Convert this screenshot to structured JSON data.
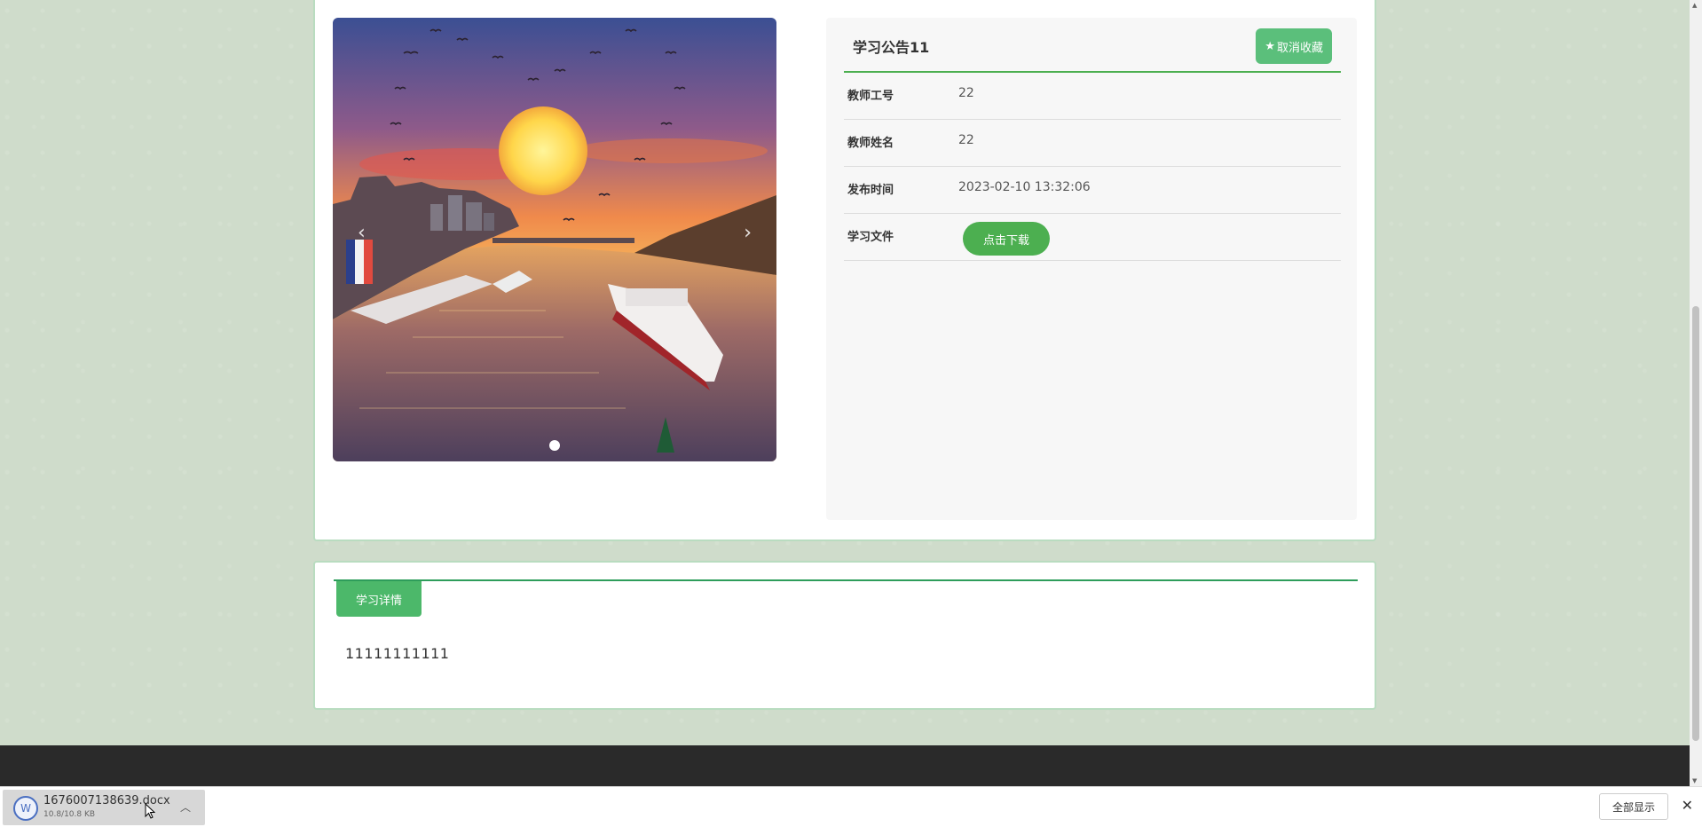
{
  "notice": {
    "title": "学习公告11",
    "favorite_button": "取消收藏",
    "favorite_icon": "star-icon",
    "rows": [
      {
        "label": "教师工号",
        "value": "22"
      },
      {
        "label": "教师姓名",
        "value": "22"
      },
      {
        "label": "发布时间",
        "value": "2023-02-10 13:32:06"
      },
      {
        "label": "学习文件",
        "button": "点击下载"
      }
    ]
  },
  "carousel": {
    "prev": "‹",
    "next": "›",
    "slide_count": 1,
    "active_slide": 1
  },
  "detail": {
    "tab_label": "学习详情",
    "content": "11111111111"
  },
  "download_shelf": {
    "file_name": "1676007138639.docx",
    "file_size": "10.8/10.8 KB",
    "show_all": "全部显示",
    "close": "✕"
  },
  "colors": {
    "accent": "#4caf50",
    "favorite_button": "#5bbf7b",
    "card_border": "#b9dcc0",
    "footer": "#2a2a2a"
  }
}
